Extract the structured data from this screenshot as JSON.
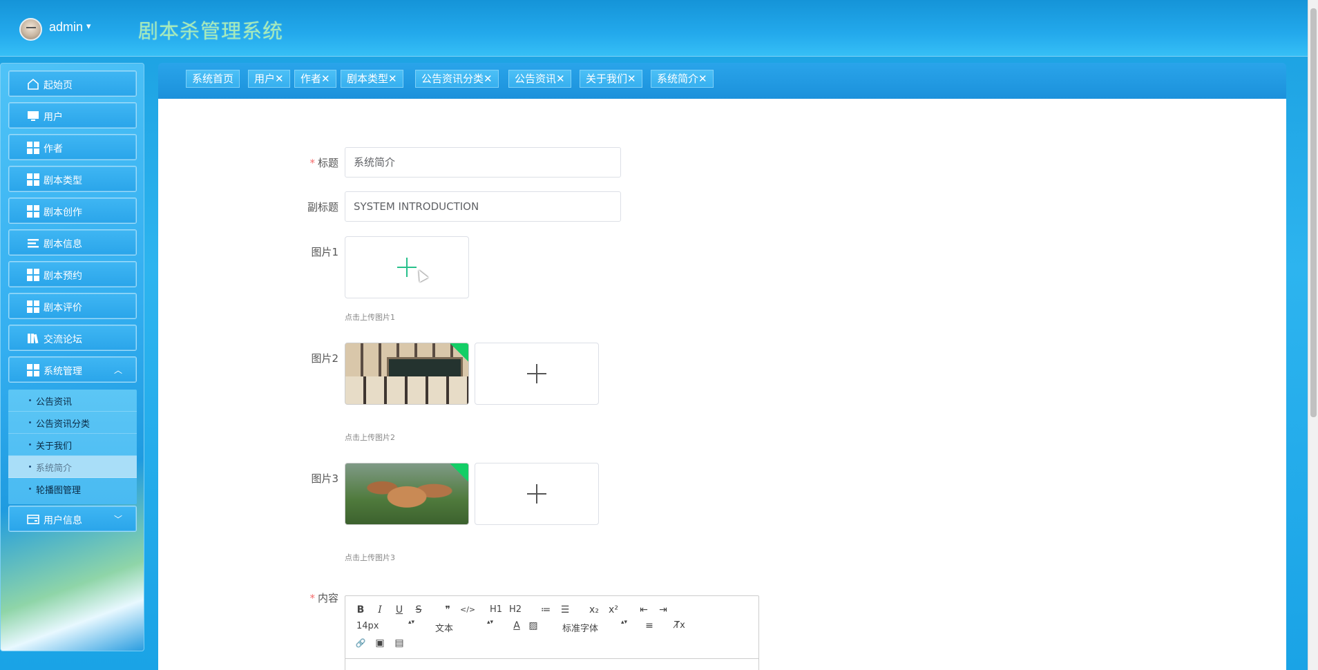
{
  "header": {
    "user": "admin",
    "user_caret": "▾",
    "app_title": "剧本杀管理系统"
  },
  "sidebar": {
    "items": [
      {
        "label": "起始页",
        "icon": "home-icon"
      },
      {
        "label": "用户",
        "icon": "monitor-icon"
      },
      {
        "label": "作者",
        "icon": "grid-icon"
      },
      {
        "label": "剧本类型",
        "icon": "grid-icon"
      },
      {
        "label": "剧本创作",
        "icon": "grid-icon"
      },
      {
        "label": "剧本信息",
        "icon": "list-icon"
      },
      {
        "label": "剧本预约",
        "icon": "grid-icon"
      },
      {
        "label": "剧本评价",
        "icon": "grid-icon"
      },
      {
        "label": "交流论坛",
        "icon": "book-icon"
      },
      {
        "label": "系统管理",
        "icon": "grid-icon",
        "chevron": "︿"
      },
      {
        "label": "用户信息",
        "icon": "card-icon",
        "chevron": "﹀"
      }
    ],
    "submenu": [
      {
        "label": "公告资讯"
      },
      {
        "label": "公告资讯分类"
      },
      {
        "label": "关于我们"
      },
      {
        "label": "系统简介",
        "active": true
      },
      {
        "label": "轮播图管理"
      }
    ]
  },
  "tabs": [
    {
      "label": "系统首页"
    },
    {
      "label": "用户✕"
    },
    {
      "label": "作者✕"
    },
    {
      "label": "剧本类型✕"
    },
    {
      "label": "公告资讯分类✕"
    },
    {
      "label": "公告资讯✕"
    },
    {
      "label": "关于我们✕"
    },
    {
      "label": "系统简介✕"
    }
  ],
  "form": {
    "title_label": "标题",
    "title_value": "系统简介",
    "subtitle_label": "副标题",
    "subtitle_value": "SYSTEM INTRODUCTION",
    "img1_label": "图片1",
    "img1_hint": "点击上传图片1",
    "img2_label": "图片2",
    "img2_hint": "点击上传图片2",
    "img3_label": "图片3",
    "img3_hint": "点击上传图片3",
    "content_label": "内容",
    "required_mark": "*"
  },
  "editor": {
    "buttons_row1": [
      "B",
      "I",
      "U",
      "S",
      "❞",
      "</>",
      "H1",
      "H2",
      "≔",
      "☰",
      "x₂",
      "x²",
      "⇤",
      "⇥"
    ],
    "font_size": "14px",
    "text_type": "文本",
    "font_family": "标准字体",
    "select_arrows": "▴▾",
    "misc_buttons": [
      "A",
      "▨",
      "≡",
      "T̸x"
    ],
    "buttons_row3": [
      "🔗",
      "▣",
      "▤"
    ]
  }
}
